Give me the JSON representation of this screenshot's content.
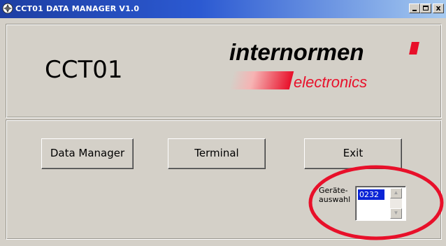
{
  "window": {
    "title": "CCT01 DATA MANAGER V1.0",
    "controls": {
      "minimize": "_",
      "maximize": "□",
      "close": "x"
    }
  },
  "header": {
    "device_title": "CCT01",
    "logo": {
      "word": "internormen",
      "sub": "electronics",
      "accent_color": "#e8102a"
    }
  },
  "buttons": {
    "data_manager": "Data Manager",
    "terminal": "Terminal",
    "exit": "Exit"
  },
  "device_select": {
    "label_line1": "Geräte-",
    "label_line2": "auswahl",
    "items": [
      "0232"
    ],
    "selected": "0232"
  },
  "annotation": {
    "color": "#e8102a",
    "shape": "ellipse"
  },
  "icons": [
    "app-icon",
    "minimize-icon",
    "maximize-icon",
    "close-icon",
    "scroll-up-icon",
    "scroll-down-icon"
  ]
}
